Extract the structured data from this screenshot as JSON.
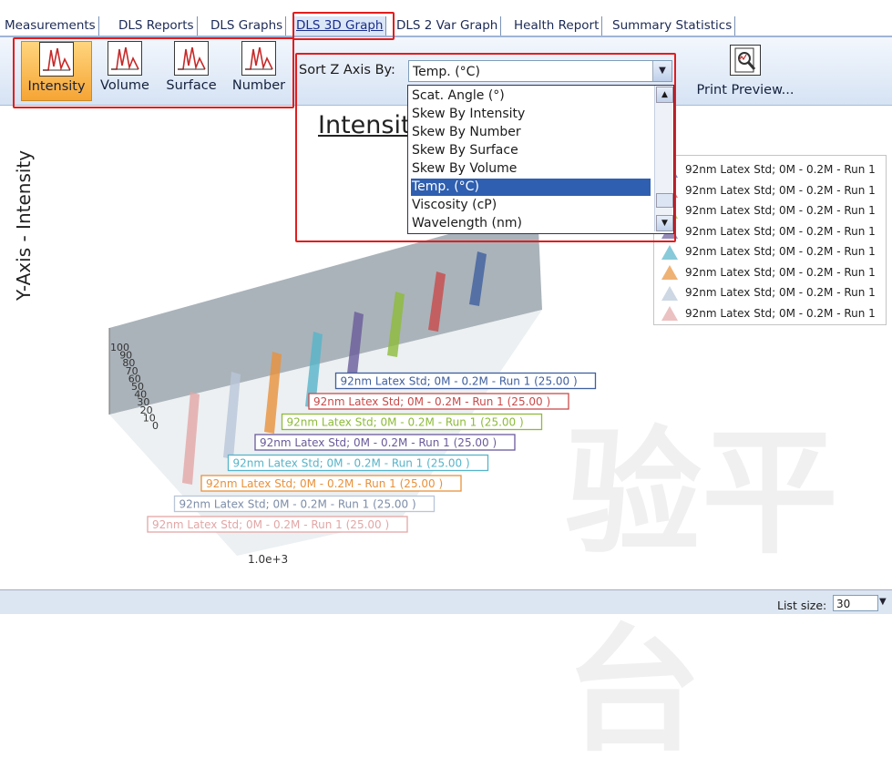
{
  "tabs": [
    {
      "label": "Measurements",
      "active": false
    },
    {
      "label": "DLS Reports",
      "active": false
    },
    {
      "label": "DLS Graphs",
      "active": false
    },
    {
      "label": "DLS 3D Graph",
      "active": true
    },
    {
      "label": "DLS 2 Var Graph",
      "active": false
    },
    {
      "label": "Health Report",
      "active": false
    },
    {
      "label": "Summary Statistics",
      "active": false
    }
  ],
  "toolbar": {
    "modes": [
      {
        "label": "Intensity",
        "active": true,
        "icon": "distribution-chart-icon"
      },
      {
        "label": "Volume",
        "active": false,
        "icon": "distribution-chart-icon"
      },
      {
        "label": "Surface",
        "active": false,
        "icon": "distribution-chart-icon"
      },
      {
        "label": "Number",
        "active": false,
        "icon": "distribution-chart-icon"
      }
    ],
    "sort_label": "Sort Z Axis By:",
    "sort_selected": "Temp. (°C)",
    "sort_options": [
      "Scat. Angle (°)",
      "Skew By Intensity",
      "Skew By Number",
      "Skew By Surface",
      "Skew By Volume",
      "Temp. (°C)",
      "Viscosity (cP)",
      "Wavelength (nm)"
    ],
    "print_label": "Print Preview..."
  },
  "chart_data": {
    "type": "bar",
    "title": "Intensit",
    "ylabel": "Y-Axis - Intensity",
    "y_ticks": [
      "100",
      "90",
      "80",
      "70",
      "60",
      "50",
      "40",
      "30",
      "20",
      "10",
      "0"
    ],
    "x_tick": "1.0e+3",
    "series": [
      {
        "name": "92nm Latex Std; 0M - 0.2M - Run 1",
        "z_label": "92nm Latex Std; 0M - 0.2M - Run 1  (25.00  )",
        "color": "#e3a6a6"
      },
      {
        "name": "92nm Latex Std; 0M - 0.2M - Run 1",
        "z_label": "92nm Latex Std; 0M - 0.2M - Run 1  (25.00  )",
        "color": "#b9c6d8"
      },
      {
        "name": "92nm Latex Std; 0M - 0.2M - Run 1",
        "z_label": "92nm Latex Std; 0M - 0.2M - Run 1  (25.00  )",
        "color": "#e8913b"
      },
      {
        "name": "92nm Latex Std; 0M - 0.2M - Run 1",
        "z_label": "92nm Latex Std; 0M - 0.2M - Run 1  (25.00  )",
        "color": "#56b4c9"
      },
      {
        "name": "92nm Latex Std; 0M - 0.2M - Run 1",
        "z_label": "92nm Latex Std; 0M - 0.2M - Run 1  (25.00  )",
        "color": "#6a5b9a"
      },
      {
        "name": "92nm Latex Std; 0M - 0.2M - Run 1",
        "z_label": "92nm Latex Std; 0M - 0.2M - Run 1  (25.00  )",
        "color": "#8dbb3a"
      },
      {
        "name": "92nm Latex Std; 0M - 0.2M - Run 1",
        "z_label": "92nm Latex Std; 0M - 0.2M - Run 1  (25.00  )",
        "color": "#c94a4a"
      },
      {
        "name": "92nm Latex Std; 0M - 0.2M - Run 1",
        "z_label": "92nm Latex Std; 0M - 0.2M - Run 1  (25.00  )",
        "color": "#3f5f9f"
      }
    ]
  },
  "legend_items": [
    {
      "label": "92nm Latex Std; 0M - 0.2M - Run 1",
      "color": "#3f5f9f"
    },
    {
      "label": "92nm Latex Std; 0M - 0.2M - Run 1",
      "color": "#c94a4a"
    },
    {
      "label": "92nm Latex Std; 0M - 0.2M - Run 1",
      "color": "#8dbb3a"
    },
    {
      "label": "92nm Latex Std; 0M - 0.2M - Run 1",
      "color": "#6a5b9a"
    },
    {
      "label": "92nm Latex Std; 0M - 0.2M - Run 1",
      "color": "#56b4c9"
    },
    {
      "label": "92nm Latex Std; 0M - 0.2M - Run 1",
      "color": "#e8913b"
    },
    {
      "label": "92nm Latex Std; 0M - 0.2M - Run 1",
      "color": "#b9c6d8"
    },
    {
      "label": "92nm Latex Std; 0M - 0.2M - Run 1",
      "color": "#e3a6a6"
    }
  ],
  "footer": {
    "list_size_label": "List size:",
    "list_size_value": "30"
  },
  "watermark": "验平台"
}
